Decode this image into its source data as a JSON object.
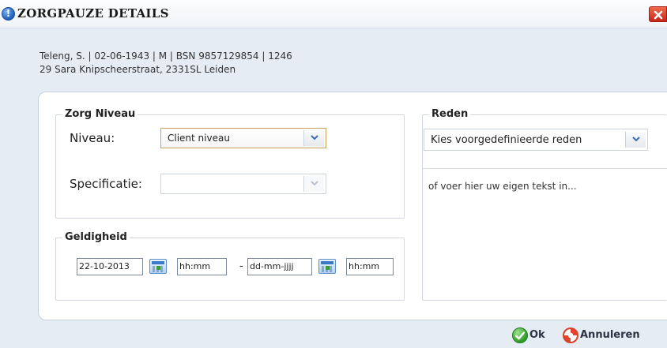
{
  "dialog": {
    "title": "ZORGPAUZE DETAILS",
    "title_icon": "info-icon",
    "close_icon": "close-icon"
  },
  "patient": {
    "line1": "Teleng, S. | 02-06-1943 | M | BSN 9857129854 | 1246",
    "line2": "29 Sara Knipscheerstraat, 2331SL Leiden"
  },
  "zorg_niveau": {
    "legend": "Zorg Niveau",
    "niveau_label": "Niveau:",
    "niveau_value": "Client niveau",
    "specificatie_label": "Specificatie:",
    "specificatie_value": ""
  },
  "geldigheid": {
    "legend": "Geldigheid",
    "start_date": "22-10-2013",
    "start_time": "hh:mm",
    "separator": "-",
    "end_date": "dd-mm-jjjj",
    "end_time": "hh:mm"
  },
  "reden": {
    "legend": "Reden",
    "select_value": "Kies voorgedefinieerde reden",
    "text_placeholder": "of voer hier uw eigen tekst in..."
  },
  "footer": {
    "ok_label": "Ok",
    "cancel_label": "Annuleren"
  },
  "colors": {
    "accent_border": "#c9a25a",
    "title_icon": "#1f5fb8",
    "close_button": "#d4321f",
    "ok_icon": "#2f9a25"
  }
}
